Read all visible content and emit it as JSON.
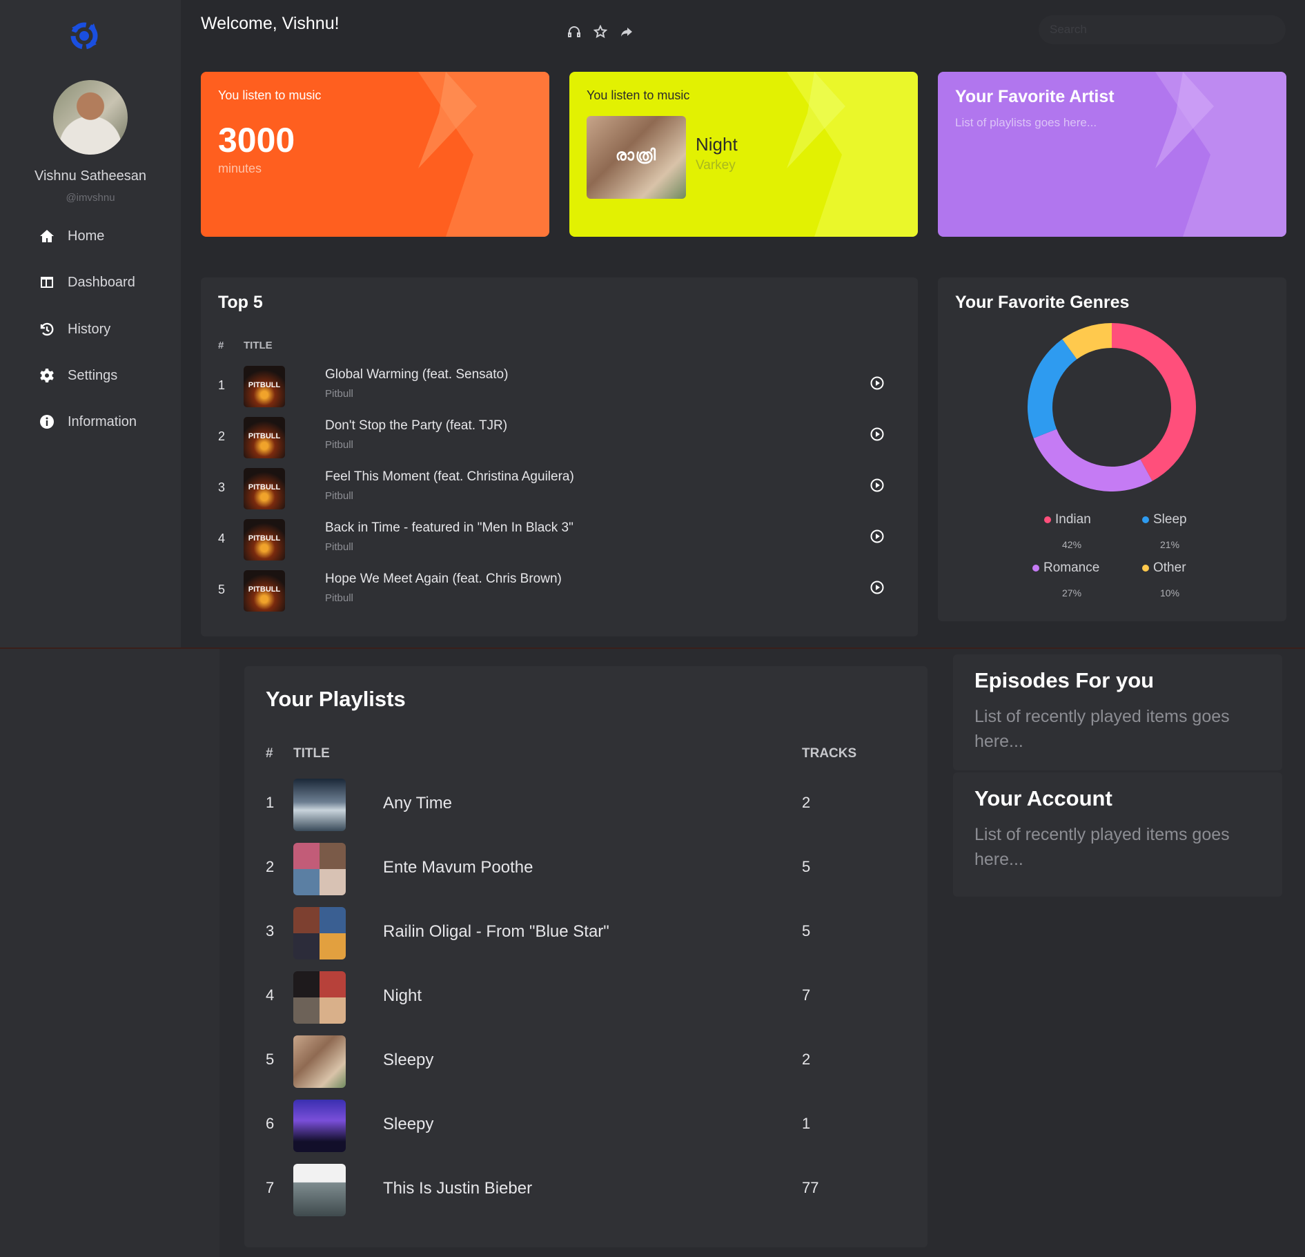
{
  "sidebar": {
    "user_name": "Vishnu Satheesan",
    "user_handle": "@imvshnu",
    "items": [
      {
        "label": "Home",
        "icon": "home-icon"
      },
      {
        "label": "Dashboard",
        "icon": "dashboard-icon"
      },
      {
        "label": "History",
        "icon": "history-icon"
      },
      {
        "label": "Settings",
        "icon": "gear-icon"
      },
      {
        "label": "Information",
        "icon": "info-icon"
      }
    ]
  },
  "header": {
    "welcome": "Welcome, Vishnu!",
    "icons": [
      "headphones-icon",
      "star-icon",
      "share-icon"
    ],
    "search_placeholder": "Search"
  },
  "cards": {
    "minutes": {
      "label": "You listen to music",
      "value": "3000",
      "unit": "minutes",
      "color": "#ff5f1f"
    },
    "song": {
      "label": "You listen to music",
      "title": "Night",
      "artist": "Varkey",
      "thumb_text": "രാത്രി",
      "color": "#e2f102"
    },
    "artist": {
      "title": "Your Favorite Artist",
      "subtitle": "List of playlists goes here...",
      "color": "#b176ee"
    }
  },
  "top5": {
    "title": "Top 5",
    "col_num": "#",
    "col_title": "TITLE",
    "thumb_text": "PITBULL",
    "rows": [
      {
        "num": "1",
        "title": "Global Warming (feat. Sensato)",
        "artist": "Pitbull"
      },
      {
        "num": "2",
        "title": "Don't Stop the Party (feat. TJR)",
        "artist": "Pitbull"
      },
      {
        "num": "3",
        "title": "Feel This Moment (feat. Christina Aguilera)",
        "artist": "Pitbull"
      },
      {
        "num": "4",
        "title": "Back in Time - featured in \"Men In Black 3\"",
        "artist": "Pitbull"
      },
      {
        "num": "5",
        "title": "Hope We Meet Again (feat. Chris Brown)",
        "artist": "Pitbull"
      }
    ]
  },
  "genres": {
    "title": "Your Favorite Genres",
    "items": [
      {
        "name": "Indian",
        "pct": "42%",
        "value": 42,
        "color": "#ff4f7b"
      },
      {
        "name": "Sleep",
        "pct": "21%",
        "value": 21,
        "color": "#2e9bf0"
      },
      {
        "name": "Romance",
        "pct": "27%",
        "value": 27,
        "color": "#c57bf4"
      },
      {
        "name": "Other",
        "pct": "10%",
        "value": 10,
        "color": "#ffc94d"
      }
    ]
  },
  "playlists": {
    "title": "Your Playlists",
    "col_num": "#",
    "col_title": "TITLE",
    "col_tracks": "TRACKS",
    "rows": [
      {
        "num": "1",
        "title": "Any Time",
        "tracks": "2"
      },
      {
        "num": "2",
        "title": "Ente Mavum Poothe",
        "tracks": "5"
      },
      {
        "num": "3",
        "title": "Railin Oligal - From \"Blue Star\"",
        "tracks": "5"
      },
      {
        "num": "4",
        "title": "Night",
        "tracks": "7"
      },
      {
        "num": "5",
        "title": "Sleepy",
        "tracks": "2"
      },
      {
        "num": "6",
        "title": "Sleepy",
        "tracks": "1"
      },
      {
        "num": "7",
        "title": "This Is Justin Bieber",
        "tracks": "77"
      }
    ]
  },
  "episodes": {
    "title": "Episodes For you",
    "subtitle": "List of recently played items goes here..."
  },
  "account": {
    "title": "Your Account",
    "subtitle": "List of recently played items goes here..."
  }
}
